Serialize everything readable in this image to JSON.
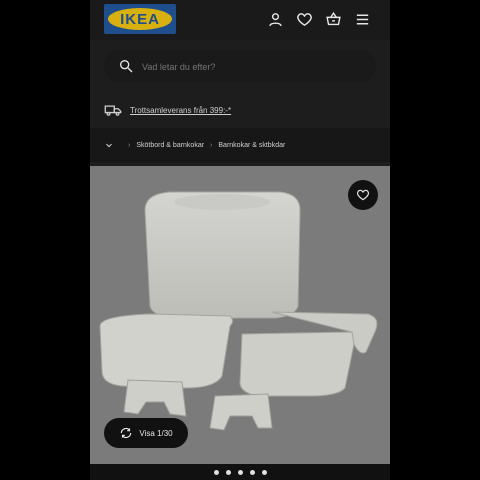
{
  "header": {
    "logo_text": "IKEA",
    "icons": [
      "user-icon",
      "heart-icon",
      "cart-icon",
      "menu-icon"
    ]
  },
  "search": {
    "placeholder": "Vad letar du efter?"
  },
  "delivery": {
    "text": "Trottsamleverans från 399:-*"
  },
  "breadcrumb": {
    "items": [
      "Skötbord & barnkokar",
      "Barnkokar & sktbkdar"
    ]
  },
  "product": {
    "view_label": "Visa 1/30"
  },
  "colors": {
    "brand_blue": "#1e4f8c",
    "brand_yellow": "#d9b10f",
    "background": "#1d1d1d",
    "image_bg": "#7b7b7b"
  }
}
